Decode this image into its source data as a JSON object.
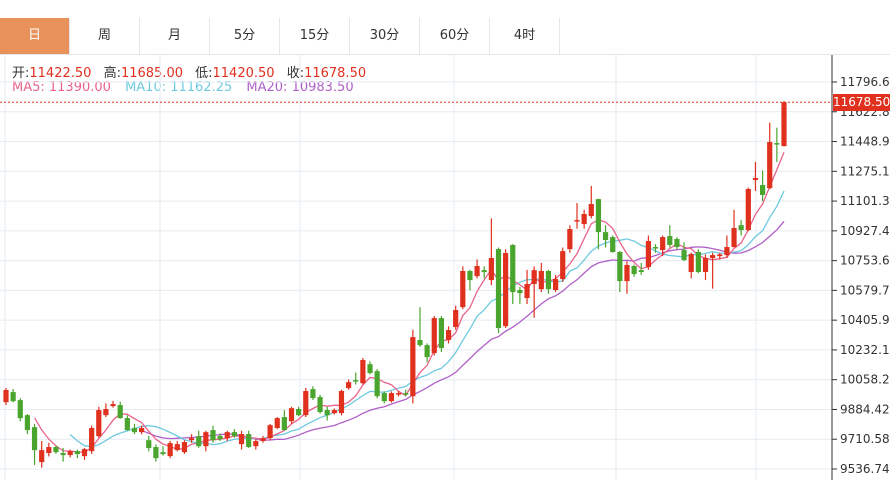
{
  "tabs": [
    "日",
    "周",
    "月",
    "5分",
    "15分",
    "30分",
    "60分",
    "4时"
  ],
  "active_tab": 0,
  "ohlc_info": {
    "open_label": "开:",
    "open": "11422.50",
    "high_label": "高:",
    "high": "11685.00",
    "low_label": "低:",
    "low": "11420.50",
    "close_label": "收:",
    "close": "11678.50"
  },
  "ma_info": {
    "ma5": "MA5: 11390.00",
    "ma10": "MA10: 11162.25",
    "ma20": "MA20: 10983.50"
  },
  "colors": {
    "up": "#e0301e",
    "down": "#4aa52e",
    "ma5": "#e8638a",
    "ma10": "#6ec9e0",
    "ma20": "#b05fc8",
    "active_tab": "#e8915a"
  },
  "chart_data": {
    "type": "candlestick",
    "y_ticks": [
      "11796.66",
      "11622.82",
      "11448.98",
      "11275.14",
      "11101.30",
      "10927.46",
      "10753.62",
      "10579.78",
      "10405.94",
      "10232.10",
      "10058.26",
      "9884.42",
      "9710.58",
      "9536.74"
    ],
    "ylim": [
      9536.74,
      11796.66
    ],
    "last_price": "11678.50",
    "candles": [
      [
        9927,
        10010,
        9910,
        9998
      ],
      [
        9986,
        10004,
        9925,
        9933
      ],
      [
        9939,
        9950,
        9815,
        9834
      ],
      [
        9851,
        9858,
        9740,
        9764
      ],
      [
        9781,
        9800,
        9560,
        9647
      ],
      [
        9577,
        9700,
        9545,
        9647
      ],
      [
        9630,
        9690,
        9610,
        9665
      ],
      [
        9665,
        9672,
        9625,
        9635
      ],
      [
        9630,
        9660,
        9580,
        9618
      ],
      [
        9618,
        9650,
        9605,
        9641
      ],
      [
        9641,
        9650,
        9600,
        9624
      ],
      [
        9612,
        9660,
        9590,
        9653
      ],
      [
        9641,
        9790,
        9625,
        9776
      ],
      [
        9729,
        9900,
        9720,
        9881
      ],
      [
        9851,
        9920,
        9840,
        9887
      ],
      [
        9904,
        9935,
        9895,
        9916
      ],
      [
        9910,
        9930,
        9830,
        9834
      ],
      [
        9834,
        9850,
        9760,
        9764
      ],
      [
        9776,
        9800,
        9740,
        9752
      ],
      [
        9752,
        9790,
        9740,
        9776
      ],
      [
        9705,
        9730,
        9640,
        9659
      ],
      [
        9665,
        9680,
        9580,
        9600
      ],
      [
        9635,
        9670,
        9615,
        9624
      ],
      [
        9612,
        9700,
        9600,
        9688
      ],
      [
        9647,
        9700,
        9640,
        9682
      ],
      [
        9635,
        9705,
        9625,
        9694
      ],
      [
        9705,
        9740,
        9690,
        9717
      ],
      [
        9729,
        9760,
        9660,
        9670
      ],
      [
        9670,
        9760,
        9640,
        9752
      ],
      [
        9764,
        9790,
        9690,
        9705
      ],
      [
        9729,
        9745,
        9700,
        9711
      ],
      [
        9717,
        9760,
        9700,
        9752
      ],
      [
        9752,
        9770,
        9720,
        9729
      ],
      [
        9682,
        9760,
        9650,
        9741
      ],
      [
        9741,
        9760,
        9660,
        9665
      ],
      [
        9670,
        9710,
        9650,
        9700
      ],
      [
        9700,
        9730,
        9690,
        9717
      ],
      [
        9717,
        9800,
        9705,
        9793
      ],
      [
        9776,
        9840,
        9770,
        9834
      ],
      [
        9840,
        9880,
        9760,
        9764
      ],
      [
        9816,
        9900,
        9800,
        9892
      ],
      [
        9887,
        9900,
        9845,
        9851
      ],
      [
        9851,
        10010,
        9840,
        9992
      ],
      [
        10003,
        10020,
        9940,
        9951
      ],
      [
        9957,
        9970,
        9860,
        9869
      ],
      [
        9881,
        9900,
        9820,
        9851
      ],
      [
        9863,
        9890,
        9855,
        9881
      ],
      [
        9863,
        10000,
        9850,
        9992
      ],
      [
        10009,
        10060,
        10000,
        10044
      ],
      [
        10056,
        10100,
        10030,
        10050
      ],
      [
        10038,
        10185,
        10030,
        10173
      ],
      [
        10149,
        10165,
        10090,
        10097
      ],
      [
        10108,
        10120,
        9950,
        9962
      ],
      [
        9980,
        9990,
        9920,
        9933
      ],
      [
        9933,
        9990,
        9925,
        9980
      ],
      [
        9980,
        9992,
        9960,
        9980
      ],
      [
        9980,
        10000,
        9960,
        9974
      ],
      [
        9962,
        10350,
        9920,
        10307
      ],
      [
        10290,
        10482,
        10250,
        10260
      ],
      [
        10260,
        10270,
        10160,
        10190
      ],
      [
        10214,
        10430,
        10200,
        10418
      ],
      [
        10418,
        10430,
        10220,
        10243
      ],
      [
        10290,
        10370,
        10270,
        10348
      ],
      [
        10366,
        10490,
        10350,
        10465
      ],
      [
        10482,
        10720,
        10470,
        10693
      ],
      [
        10693,
        10700,
        10580,
        10640
      ],
      [
        10663,
        10760,
        10650,
        10722
      ],
      [
        10698,
        10720,
        10650,
        10687
      ],
      [
        10640,
        11000,
        10610,
        10769
      ],
      [
        10821,
        10830,
        10330,
        10360
      ],
      [
        10371,
        10820,
        10360,
        10798
      ],
      [
        10845,
        10850,
        10500,
        10570
      ],
      [
        10582,
        10600,
        10500,
        10564
      ],
      [
        10535,
        10700,
        10500,
        10617
      ],
      [
        10617,
        10720,
        10420,
        10698
      ],
      [
        10587,
        10740,
        10570,
        10693
      ],
      [
        10693,
        10700,
        10560,
        10587
      ],
      [
        10582,
        10670,
        10570,
        10646
      ],
      [
        10646,
        10830,
        10630,
        10809
      ],
      [
        10821,
        10960,
        10800,
        10938
      ],
      [
        10990,
        11090,
        10940,
        10990
      ],
      [
        10967,
        11050,
        10940,
        11026
      ],
      [
        11014,
        11190,
        11000,
        11084
      ],
      [
        11113,
        11115,
        10820,
        10920
      ],
      [
        10920,
        10960,
        10830,
        10874
      ],
      [
        10891,
        10900,
        10800,
        10804
      ],
      [
        10804,
        10810,
        10570,
        10634
      ],
      [
        10634,
        10750,
        10560,
        10728
      ],
      [
        10722,
        10730,
        10660,
        10675
      ],
      [
        10698,
        10740,
        10670,
        10687
      ],
      [
        10716,
        10900,
        10700,
        10868
      ],
      [
        10833,
        10850,
        10800,
        10827
      ],
      [
        10815,
        10900,
        10780,
        10891
      ],
      [
        10897,
        10960,
        10830,
        10845
      ],
      [
        10880,
        10890,
        10820,
        10833
      ],
      [
        10815,
        10860,
        10750,
        10757
      ],
      [
        10687,
        10800,
        10650,
        10792
      ],
      [
        10804,
        10820,
        10680,
        10687
      ],
      [
        10687,
        10790,
        10640,
        10769
      ],
      [
        10769,
        10800,
        10590,
        10786
      ],
      [
        10780,
        10800,
        10760,
        10790
      ],
      [
        10786,
        10900,
        10770,
        10833
      ],
      [
        10833,
        11050,
        10830,
        10944
      ],
      [
        10961,
        10990,
        10900,
        10932
      ],
      [
        10932,
        11180,
        10925,
        11172
      ],
      [
        11224,
        11330,
        11160,
        11236
      ],
      [
        11195,
        11280,
        11100,
        11137
      ],
      [
        11177,
        11560,
        11170,
        11446
      ],
      [
        11440,
        11530,
        11330,
        11435
      ],
      [
        11422.5,
        11685,
        11420.5,
        11678.5
      ]
    ]
  }
}
